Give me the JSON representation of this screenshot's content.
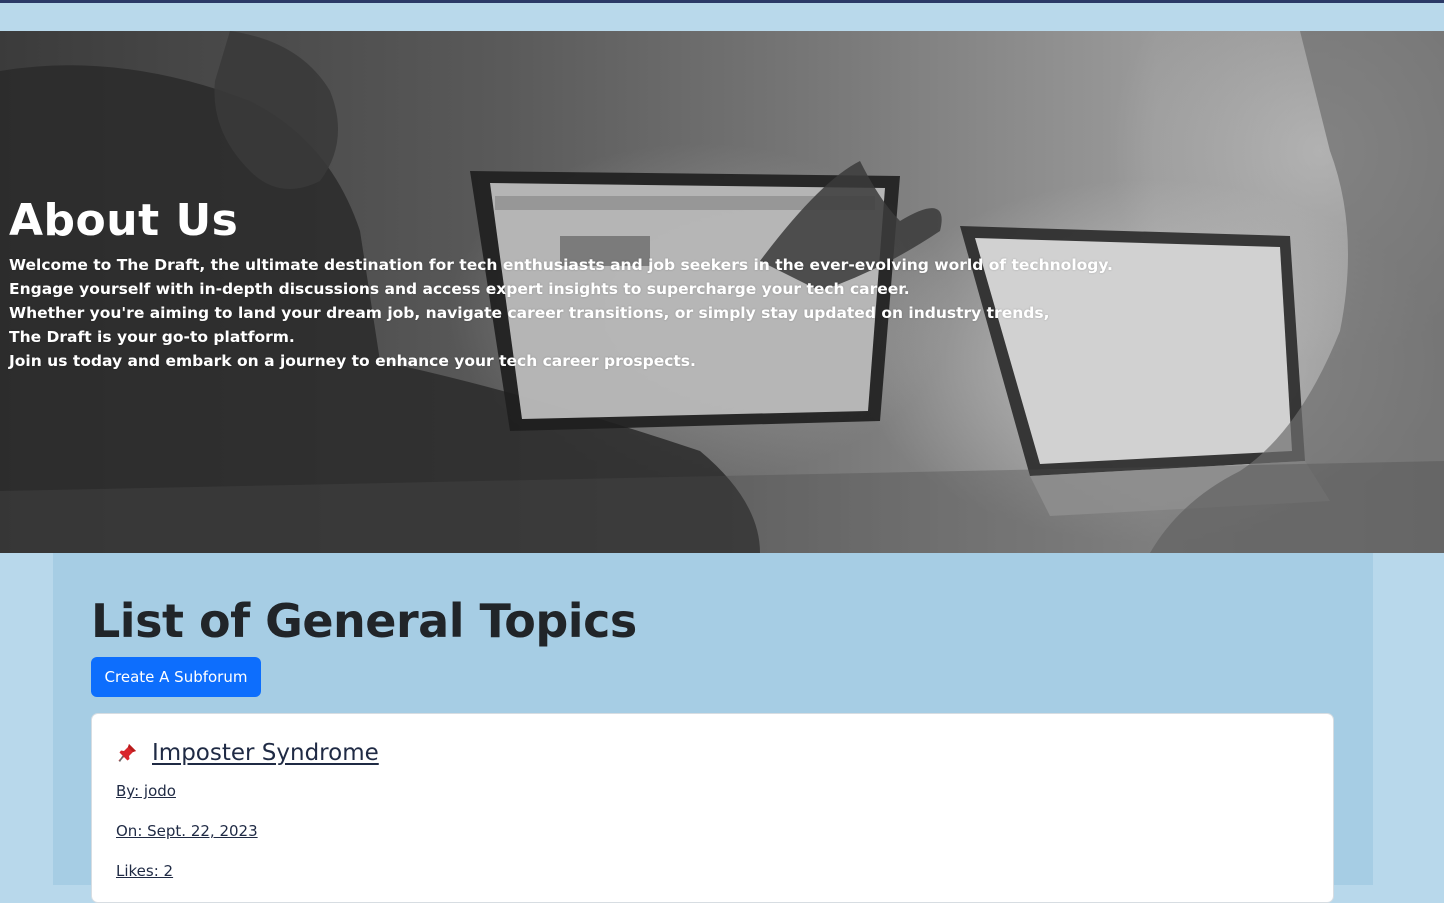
{
  "hero": {
    "title": "About Us",
    "lines": [
      "Welcome to The Draft, the ultimate destination for tech enthusiasts and job seekers in the ever-evolving world of technology.",
      "Engage yourself with in-depth discussions and access expert insights to supercharge your tech career.",
      "Whether you're aiming to land your dream job, navigate career transitions, or simply stay updated on industry trends,",
      "The Draft is your go-to platform.",
      "Join us today and embark on a journey to enhance your tech career prospects."
    ]
  },
  "topics_section": {
    "title": "List of General Topics",
    "create_button_label": "Create A Subforum",
    "topics": [
      {
        "icon": "pushpin-icon",
        "title": "Imposter Syndrome",
        "author": "By: jodo",
        "date": "On: Sept. 22, 2023",
        "likes": "Likes: 2"
      }
    ]
  },
  "colors": {
    "page_background": "#b8d8eb",
    "panel_background": "#a6cde4",
    "top_bar": "#2b3a67",
    "primary_button": "#0d6efd",
    "heading_text": "#212529",
    "link_text": "#1f2a44"
  }
}
